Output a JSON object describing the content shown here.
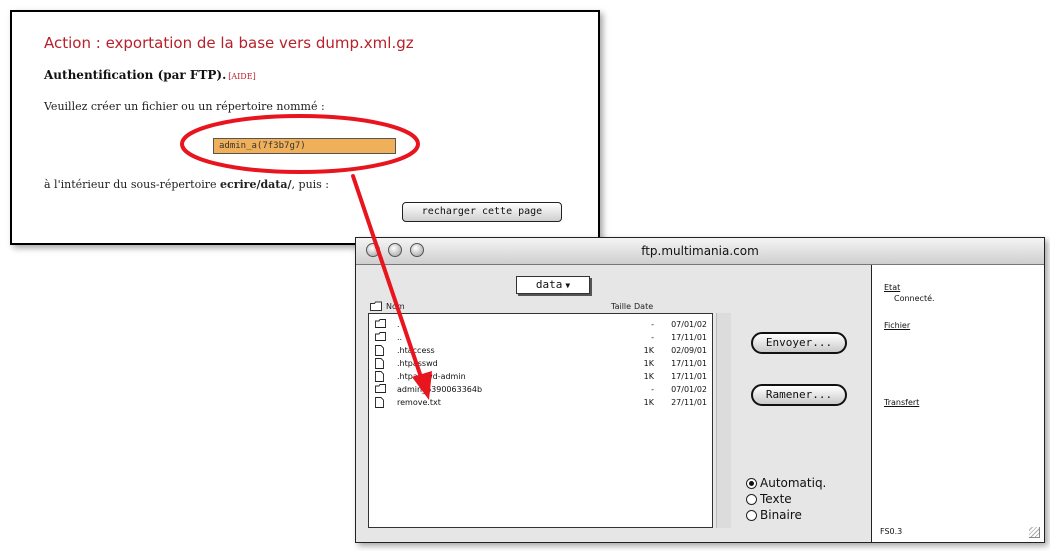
{
  "webpage": {
    "title": "Action : exportation de la base vers dump.xml.gz",
    "auth_heading": "Authentification (par FTP).",
    "help_link": "[AIDE]",
    "instruction": "Veuillez créer un fichier ou un répertoire nommé :",
    "code_value": "admin_a(7f3b7g7)",
    "location_prefix": "à l'intérieur du sous-répertoire ",
    "location_dir": "ecrire/data/",
    "location_suffix": ", puis :",
    "reload_button": "recharger cette page"
  },
  "ftp": {
    "window_title": "ftp.multimania.com",
    "folder": "data",
    "columns": {
      "name": "Nom",
      "size": "Taille",
      "date": "Date"
    },
    "files": [
      {
        "name": ".",
        "size": "-",
        "date": "07/01/02",
        "type": "folder"
      },
      {
        "name": "..",
        "size": "-",
        "date": "17/11/01",
        "type": "folder"
      },
      {
        "name": ".htaccess",
        "size": "1K",
        "date": "02/09/01",
        "type": "file"
      },
      {
        "name": ".htpasswd",
        "size": "1K",
        "date": "17/11/01",
        "type": "file"
      },
      {
        "name": ".htpasswd-admin",
        "size": "1K",
        "date": "17/11/01",
        "type": "file"
      },
      {
        "name": "admin_6390063364b",
        "size": "-",
        "date": "07/01/02",
        "type": "folder"
      },
      {
        "name": "remove.txt",
        "size": "1K",
        "date": "27/11/01",
        "type": "file"
      }
    ],
    "send_button": "Envoyer...",
    "get_button": "Ramener...",
    "modes": [
      {
        "label": "Automatiq.",
        "selected": true
      },
      {
        "label": "Texte",
        "selected": false
      },
      {
        "label": "Binaire",
        "selected": false
      }
    ],
    "status": {
      "etat_label": "Etat",
      "etat_value": "Connecté.",
      "fichier_label": "Fichier",
      "transfert_label": "Transfert",
      "version": "FS0.3"
    }
  },
  "colors": {
    "title_red": "#b8202a",
    "highlight_orange": "#f0b05a",
    "annotation_red": "#e8141e"
  }
}
